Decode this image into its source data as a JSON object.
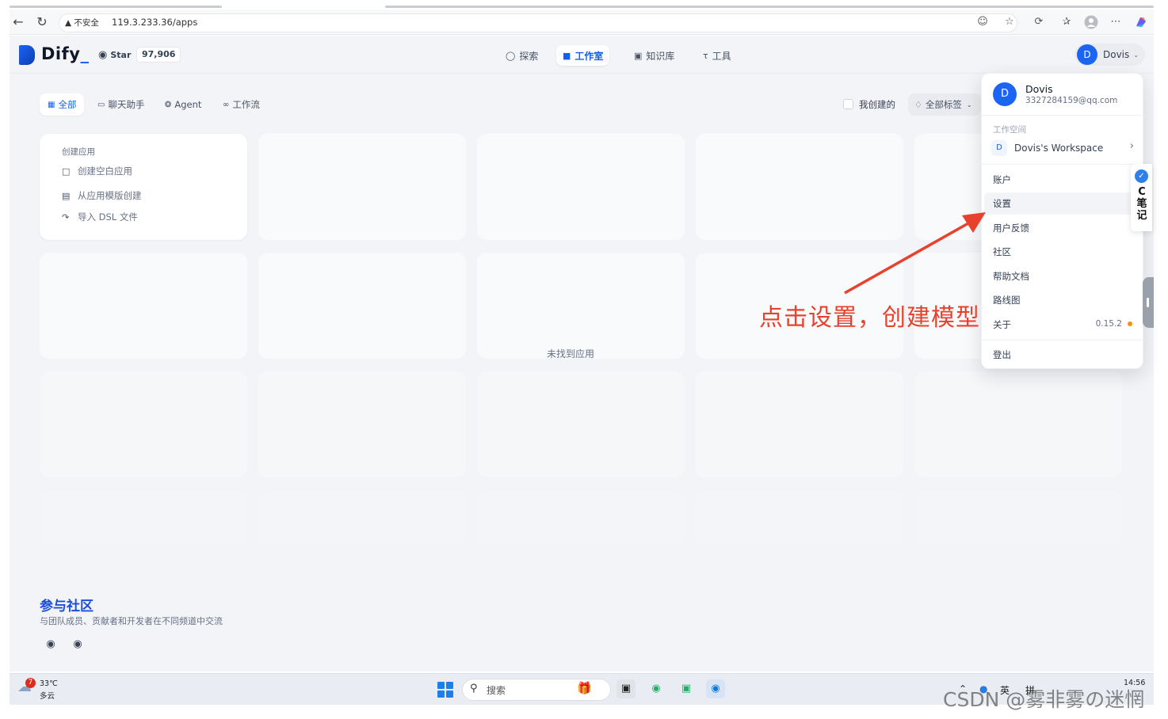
{
  "browser": {
    "security_label": "不安全",
    "url": "119.3.233.36/apps"
  },
  "header": {
    "logo_text": "Dify",
    "github_star_label": "Star",
    "github_star_count": "97,906",
    "nav": [
      {
        "label": "探索",
        "icon": "compass-icon"
      },
      {
        "label": "工作室",
        "icon": "robot-icon"
      },
      {
        "label": "知识库",
        "icon": "book-icon"
      },
      {
        "label": "工具",
        "icon": "tool-icon"
      }
    ],
    "user_initial": "D",
    "user_name": "Dovis"
  },
  "filters": {
    "tabs": [
      {
        "label": "全部",
        "icon": "grid-icon"
      },
      {
        "label": "聊天助手",
        "icon": "chat-icon"
      },
      {
        "label": "Agent",
        "icon": "agent-icon"
      },
      {
        "label": "工作流",
        "icon": "workflow-icon"
      }
    ],
    "mine_label": "我创建的",
    "tags_label": "全部标签"
  },
  "create_card": {
    "title": "创建应用",
    "items": [
      {
        "label": "创建空白应用",
        "icon": "file-plus-icon"
      },
      {
        "label": "从应用模版创建",
        "icon": "template-icon"
      },
      {
        "label": "导入 DSL 文件",
        "icon": "import-icon"
      }
    ]
  },
  "empty_state": "未找到应用",
  "community": {
    "title": "参与社区",
    "subtitle": "与团队成员、贡献者和开发者在不同频道中交流"
  },
  "dropdown": {
    "initial": "D",
    "name": "Dovis",
    "email": "3327284159@qq.com",
    "workspace_section": "工作空间",
    "workspace_initial": "D",
    "workspace_name": "Dovis's Workspace",
    "items": [
      "账户",
      "设置",
      "用户反馈",
      "社区",
      "帮助文档",
      "路线图",
      "关于"
    ],
    "version": "0.15.2",
    "logout": "登出"
  },
  "annotation": "点击设置，创建模型",
  "side_note": {
    "letter": "C",
    "text": "笔记"
  },
  "taskbar": {
    "weather_badge": "7",
    "temperature": "33℃",
    "weather": "多云",
    "search_label": "搜索",
    "tray_lang": "英",
    "tray_ime": "拼",
    "time": "14:56"
  },
  "watermark": "CSDN @雾非雾の迷惘",
  "colors": {
    "accent": "#155eef",
    "annotation": "#e8412d",
    "version_dot": "#f79009"
  }
}
